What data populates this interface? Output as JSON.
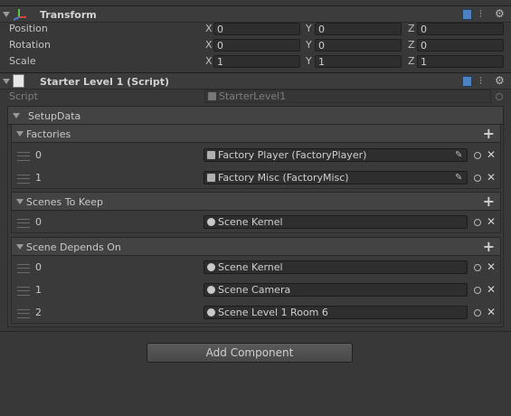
{
  "transform": {
    "title": "Transform",
    "rows": [
      {
        "label": "Position",
        "x": "0",
        "y": "0",
        "z": "0"
      },
      {
        "label": "Rotation",
        "x": "0",
        "y": "0",
        "z": "0"
      },
      {
        "label": "Scale",
        "x": "1",
        "y": "1",
        "z": "1"
      }
    ],
    "axis": {
      "x": "X",
      "y": "Y",
      "z": "Z"
    }
  },
  "script_component": {
    "title": "Starter Level 1 (Script)",
    "script_label": "Script",
    "script_value": "StarterLevel1"
  },
  "setup_data": {
    "label": "SetupData",
    "factories": {
      "label": "Factories",
      "items": [
        {
          "index": "0",
          "value": "Factory Player (FactoryPlayer)"
        },
        {
          "index": "1",
          "value": "Factory Misc (FactoryMisc)"
        }
      ]
    },
    "scenes_to_keep": {
      "label": "Scenes To Keep",
      "items": [
        {
          "index": "0",
          "value": "Scene Kernel"
        }
      ]
    },
    "scene_depends_on": {
      "label": "Scene Depends On",
      "items": [
        {
          "index": "0",
          "value": "Scene Kernel"
        },
        {
          "index": "1",
          "value": "Scene Camera"
        },
        {
          "index": "2",
          "value": "Scene Level 1 Room 6"
        }
      ]
    }
  },
  "add_component_label": "Add Component",
  "icons": {
    "help": "book-icon",
    "presets": "slider-icon",
    "settings": "gear-icon",
    "add": "plus-icon",
    "remove": "close-icon",
    "pick": "object-picker-icon",
    "edit": "pencil-icon",
    "drag": "drag-handle-icon"
  }
}
